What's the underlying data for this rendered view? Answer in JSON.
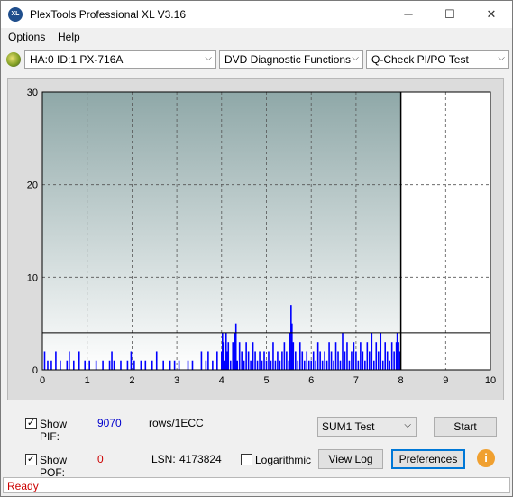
{
  "window": {
    "title": "PlexTools Professional XL V3.16",
    "app_icon_text": "XL",
    "minimize": "─",
    "maximize": "☐",
    "close": "✕"
  },
  "menu": {
    "items": [
      "Options",
      "Help"
    ]
  },
  "toolbar": {
    "drive": "HA:0 ID:1  PX-716A",
    "function": "DVD Diagnostic Functions",
    "test": "Q-Check PI/PO Test",
    "arrow": "⌵"
  },
  "chart_data": {
    "type": "bar",
    "xlabel": "",
    "ylabel": "",
    "xlim": [
      0,
      10
    ],
    "ylim": [
      0,
      30
    ],
    "x_ticks": [
      "0",
      "1",
      "2",
      "3",
      "4",
      "5",
      "6",
      "7",
      "8",
      "9",
      "10"
    ],
    "y_ticks": [
      "0",
      "10",
      "20",
      "30"
    ],
    "grid": true,
    "threshold_line": 4,
    "scan_end_x": 8,
    "background_top": "#8fa8a8",
    "background_bottom": "#ffffff",
    "bar_color": "#0000ff",
    "series": [
      {
        "values": [
          [
            0.05,
            2
          ],
          [
            0.12,
            1
          ],
          [
            0.2,
            1
          ],
          [
            0.3,
            2
          ],
          [
            0.4,
            1
          ],
          [
            0.55,
            1
          ],
          [
            0.6,
            2
          ],
          [
            0.7,
            1
          ],
          [
            0.82,
            2
          ],
          [
            0.95,
            1
          ],
          [
            1.05,
            1
          ],
          [
            1.2,
            1
          ],
          [
            1.35,
            1
          ],
          [
            1.5,
            1
          ],
          [
            1.55,
            2
          ],
          [
            1.6,
            1
          ],
          [
            1.75,
            1
          ],
          [
            1.9,
            1
          ],
          [
            1.98,
            2
          ],
          [
            2.05,
            1
          ],
          [
            2.2,
            1
          ],
          [
            2.3,
            1
          ],
          [
            2.45,
            1
          ],
          [
            2.55,
            2
          ],
          [
            2.7,
            1
          ],
          [
            2.85,
            1
          ],
          [
            2.95,
            1
          ],
          [
            3.05,
            1
          ],
          [
            3.25,
            1
          ],
          [
            3.35,
            1
          ],
          [
            3.55,
            2
          ],
          [
            3.65,
            1
          ],
          [
            3.7,
            2
          ],
          [
            3.8,
            1
          ],
          [
            3.9,
            2
          ],
          [
            4.0,
            2
          ],
          [
            4.02,
            4
          ],
          [
            4.05,
            3
          ],
          [
            4.08,
            1
          ],
          [
            4.1,
            4
          ],
          [
            4.12,
            2
          ],
          [
            4.15,
            3
          ],
          [
            4.2,
            1
          ],
          [
            4.25,
            3
          ],
          [
            4.28,
            2
          ],
          [
            4.3,
            4
          ],
          [
            4.32,
            5
          ],
          [
            4.35,
            1
          ],
          [
            4.4,
            3
          ],
          [
            4.45,
            2
          ],
          [
            4.5,
            1
          ],
          [
            4.55,
            3
          ],
          [
            4.6,
            2
          ],
          [
            4.65,
            1
          ],
          [
            4.7,
            3
          ],
          [
            4.75,
            2
          ],
          [
            4.8,
            1
          ],
          [
            4.85,
            2
          ],
          [
            4.9,
            1
          ],
          [
            4.95,
            2
          ],
          [
            5.0,
            1
          ],
          [
            5.05,
            2
          ],
          [
            5.1,
            1
          ],
          [
            5.15,
            3
          ],
          [
            5.2,
            1
          ],
          [
            5.25,
            2
          ],
          [
            5.3,
            1
          ],
          [
            5.35,
            2
          ],
          [
            5.4,
            3
          ],
          [
            5.45,
            2
          ],
          [
            5.5,
            1
          ],
          [
            5.52,
            4
          ],
          [
            5.55,
            7
          ],
          [
            5.57,
            5
          ],
          [
            5.6,
            3
          ],
          [
            5.65,
            2
          ],
          [
            5.7,
            1
          ],
          [
            5.75,
            3
          ],
          [
            5.8,
            2
          ],
          [
            5.85,
            1
          ],
          [
            5.9,
            2
          ],
          [
            5.95,
            1
          ],
          [
            6.0,
            1
          ],
          [
            6.05,
            2
          ],
          [
            6.1,
            1
          ],
          [
            6.15,
            3
          ],
          [
            6.2,
            2
          ],
          [
            6.25,
            1
          ],
          [
            6.3,
            2
          ],
          [
            6.35,
            1
          ],
          [
            6.4,
            3
          ],
          [
            6.45,
            2
          ],
          [
            6.5,
            1
          ],
          [
            6.55,
            3
          ],
          [
            6.6,
            2
          ],
          [
            6.65,
            1
          ],
          [
            6.7,
            4
          ],
          [
            6.75,
            2
          ],
          [
            6.8,
            3
          ],
          [
            6.85,
            1
          ],
          [
            6.9,
            2
          ],
          [
            6.95,
            3
          ],
          [
            7.0,
            2
          ],
          [
            7.05,
            1
          ],
          [
            7.1,
            3
          ],
          [
            7.15,
            2
          ],
          [
            7.2,
            1
          ],
          [
            7.25,
            3
          ],
          [
            7.3,
            2
          ],
          [
            7.35,
            4
          ],
          [
            7.4,
            1
          ],
          [
            7.45,
            3
          ],
          [
            7.5,
            2
          ],
          [
            7.55,
            4
          ],
          [
            7.6,
            1
          ],
          [
            7.65,
            3
          ],
          [
            7.7,
            2
          ],
          [
            7.75,
            1
          ],
          [
            7.8,
            3
          ],
          [
            7.85,
            2
          ],
          [
            7.9,
            3
          ],
          [
            7.92,
            4
          ],
          [
            7.95,
            3
          ],
          [
            7.98,
            2
          ]
        ]
      }
    ]
  },
  "controls": {
    "show_pif_label": "Show PIF:",
    "pif_value": "9070",
    "pif_unit": "rows/1ECC",
    "show_pof_label": "Show POF:",
    "pof_value": "0",
    "lsn_label": "LSN:",
    "lsn_value": "4173824",
    "logarithmic_label": "Logarithmic",
    "test_select": "SUM1 Test",
    "start_button": "Start",
    "view_log_button": "View Log",
    "preferences_button": "Preferences",
    "info_icon": "i",
    "check_mark": "✓",
    "pif_color": "#0000cc",
    "pof_color": "#cc0000"
  },
  "status": {
    "text": "Ready",
    "color": "#cc0000"
  }
}
